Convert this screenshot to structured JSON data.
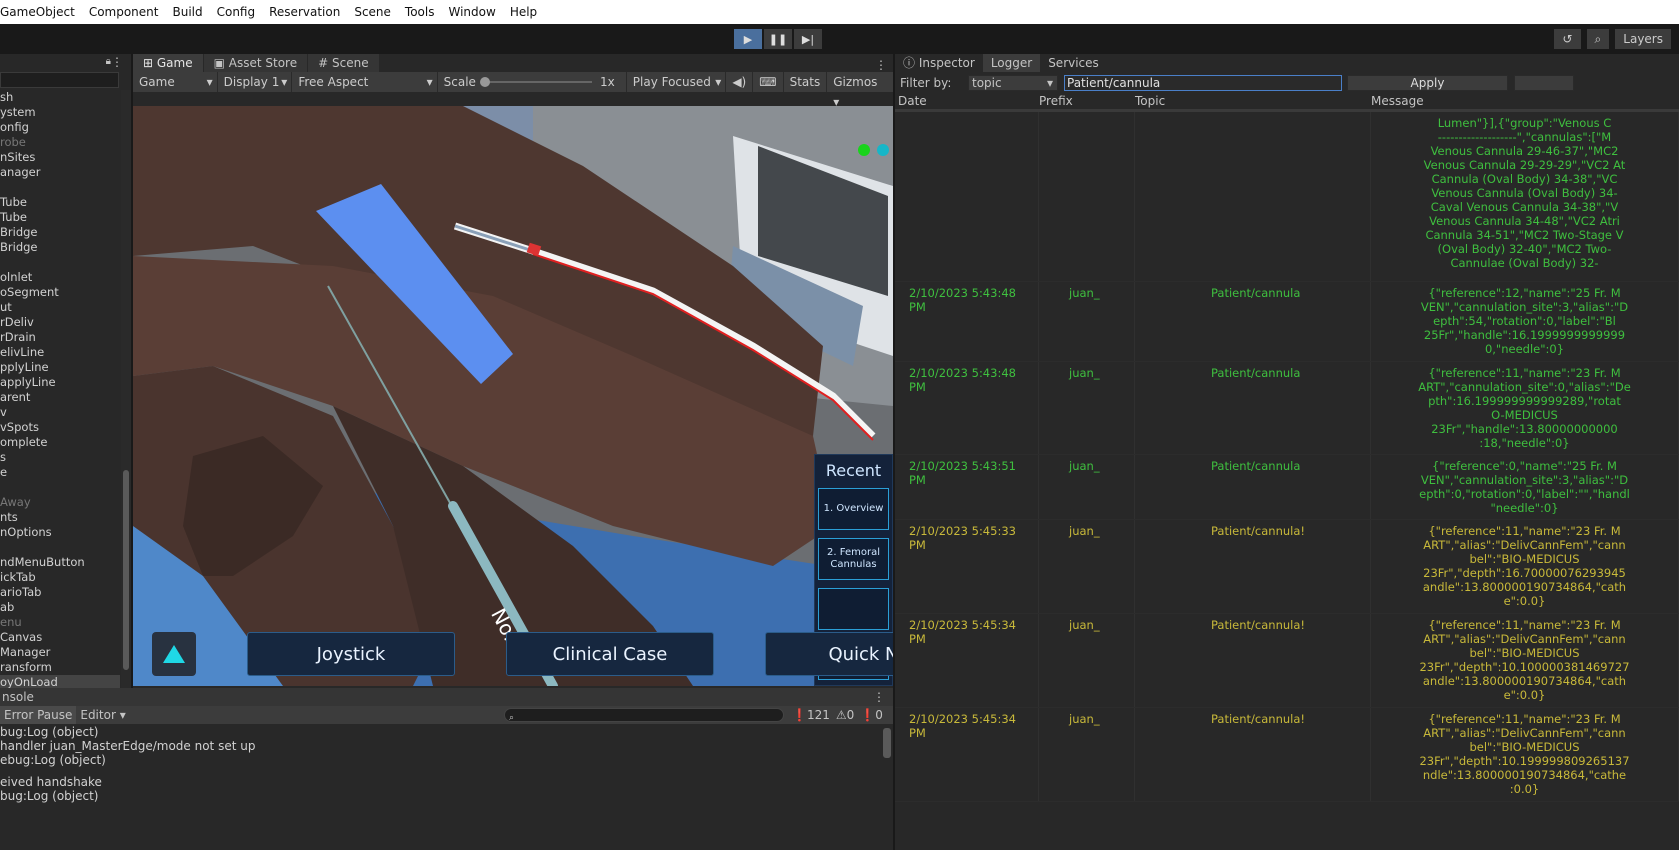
{
  "menubar": [
    "GameObject",
    "Component",
    "Build",
    "Config",
    "Reservation",
    "Scene",
    "Tools",
    "Window",
    "Help"
  ],
  "toolbar": {
    "layers_label": "Layers"
  },
  "hierarchy": {
    "items": [
      {
        "text": "sh",
        "dim": false
      },
      {
        "text": "ystem",
        "dim": false
      },
      {
        "text": "onfig",
        "dim": false
      },
      {
        "text": "robe",
        "dim": true
      },
      {
        "text": "nSites",
        "dim": false
      },
      {
        "text": "anager",
        "dim": false
      },
      {
        "text": "",
        "dim": false
      },
      {
        "text": "Tube",
        "dim": false
      },
      {
        "text": "Tube",
        "dim": false
      },
      {
        "text": "Bridge",
        "dim": false
      },
      {
        "text": "Bridge",
        "dim": false
      },
      {
        "text": "",
        "dim": false
      },
      {
        "text": "olnlet",
        "dim": false
      },
      {
        "text": "oSegment",
        "dim": false
      },
      {
        "text": "ut",
        "dim": false
      },
      {
        "text": "rDeliv",
        "dim": false
      },
      {
        "text": "rDrain",
        "dim": false
      },
      {
        "text": "elivLine",
        "dim": false
      },
      {
        "text": "pplyLine",
        "dim": false
      },
      {
        "text": "applyLine",
        "dim": false
      },
      {
        "text": "arent",
        "dim": false
      },
      {
        "text": "v",
        "dim": false
      },
      {
        "text": "vSpots",
        "dim": false
      },
      {
        "text": "omplete",
        "dim": false
      },
      {
        "text": "s",
        "dim": false
      },
      {
        "text": "e",
        "dim": false
      },
      {
        "text": "",
        "dim": false
      },
      {
        "text": "Away",
        "dim": true
      },
      {
        "text": "nts",
        "dim": false
      },
      {
        "text": "nOptions",
        "dim": false
      },
      {
        "text": "",
        "dim": false
      },
      {
        "text": "ndMenuButton",
        "dim": false
      },
      {
        "text": "ickTab",
        "dim": false
      },
      {
        "text": "arioTab",
        "dim": false
      },
      {
        "text": "ab",
        "dim": false
      },
      {
        "text": "enu",
        "dim": true
      },
      {
        "text": "Canvas",
        "dim": false
      },
      {
        "text": "Manager",
        "dim": false
      },
      {
        "text": "ransform",
        "dim": false
      },
      {
        "text": "oyOnLoad",
        "dim": false
      }
    ]
  },
  "game": {
    "tabs": [
      "Game",
      "Asset Store",
      "Scene"
    ],
    "view_dropdown": "Game",
    "display": "Display 1",
    "aspect": "Free Aspect",
    "scale_label": "Scale",
    "scale_value": "1x",
    "play_mode": "Play Focused",
    "stats": "Stats",
    "gizmos": "Gizmos",
    "recent": {
      "title": "Recent",
      "items": [
        "1. Overview",
        "2. Femoral Cannulas",
        "",
        ""
      ]
    },
    "buttons": [
      "Joystick",
      "Clinical Case",
      "Quick Na"
    ],
    "needle_label": "None"
  },
  "console": {
    "tab": "nsole",
    "error_pause": "Error Pause",
    "editor": "Editor",
    "counts": {
      "logs": "121",
      "warnings": "0",
      "errors": "0"
    },
    "lines": [
      "bug:Log (object)",
      "handler juan_MasterEdge/mode not set up",
      "ebug:Log (object)",
      "eived handshake",
      "bug:Log (object)"
    ]
  },
  "inspector": {
    "tabs": [
      "Inspector",
      "Logger",
      "Services"
    ],
    "filter_label": "Filter by:",
    "filter_type": "topic",
    "filter_value": "Patient/cannula",
    "apply_label": "Apply",
    "columns": [
      "Date",
      "Prefix",
      "Topic",
      "Message"
    ],
    "rows": [
      {
        "date": "",
        "prefix": "",
        "topic": "",
        "color": "green",
        "message": "Lumen\"}],{\"group\":\"Venous C\n-------------------\",\"cannulas\":[\"M\nVenous Cannula 29-46-37\",\"MC2\nVenous Cannula 29-29-29\",\"VC2 At\nCannula (Oval Body) 34-38\",\"VC\nVenous Cannula (Oval Body) 34-\nCaval Venous Cannula 34-38\",\"V\nVenous Cannula 34-48\",\"VC2 Atri\nCannula 34-51\",\"MC2 Two-Stage V\n(Oval Body) 32-40\",\"MC2 Two-\nCannulae (Oval Body) 32-"
      },
      {
        "date": "2/10/2023 5:43:48 PM",
        "prefix": "juan_",
        "topic": "Patient/cannula",
        "color": "green",
        "message": "{\"reference\":12,\"name\":\"25 Fr. M\nVEN\",\"cannulation_site\":3,\"alias\":\"D\nepth\":54,\"rotation\":0,\"label\":\"Bl\n25Fr\",\"handle\":16.1999999999999\n0,\"needle\":0}"
      },
      {
        "date": "2/10/2023 5:43:48 PM",
        "prefix": "juan_",
        "topic": "Patient/cannula",
        "color": "green",
        "message": "{\"reference\":11,\"name\":\"23 Fr. M\nART\",\"cannulation_site\":0,\"alias\":\"De\npth\":16.199999999999289,\"rotat\nO-MEDICUS\n23Fr\",\"handle\":13.80000000000\n:18,\"needle\":0}"
      },
      {
        "date": "2/10/2023 5:43:51 PM",
        "prefix": "juan_",
        "topic": "Patient/cannula",
        "color": "green",
        "message": "{\"reference\":0,\"name\":\"25 Fr. M\nVEN\",\"cannulation_site\":3,\"alias\":\"D\nepth\":0,\"rotation\":0,\"label\":\"\",\"handl\n\"needle\":0}"
      },
      {
        "date": "2/10/2023 5:45:33 PM",
        "prefix": "juan_",
        "topic": "Patient/cannula!",
        "color": "olive",
        "message": "{\"reference\":11,\"name\":\"23 Fr. M\nART\",\"alias\":\"DelivCannFem\",\"cann\nbel\":\"BIO-MEDICUS\n23Fr\",\"depth\":16.70000076293945\nandle\":13.800000190734864,\"cath\ne\":0.0}"
      },
      {
        "date": "2/10/2023 5:45:34 PM",
        "prefix": "juan_",
        "topic": "Patient/cannula!",
        "color": "olive",
        "message": "{\"reference\":11,\"name\":\"23 Fr. M\nART\",\"alias\":\"DelivCannFem\",\"cann\nbel\":\"BIO-MEDICUS\n23Fr\",\"depth\":10.100000381469727\nandle\":13.800000190734864,\"cath\ne\":0.0}"
      },
      {
        "date": "2/10/2023 5:45:34 PM",
        "prefix": "juan_",
        "topic": "Patient/cannula!",
        "color": "olive",
        "message": "{\"reference\":11,\"name\":\"23 Fr. M\nART\",\"alias\":\"DelivCannFem\",\"cann\nbel\":\"BIO-MEDICUS\n23Fr\",\"depth\":10.199999809265137\nndle\":13.800000190734864,\"cathe\n:0.0}"
      }
    ]
  }
}
